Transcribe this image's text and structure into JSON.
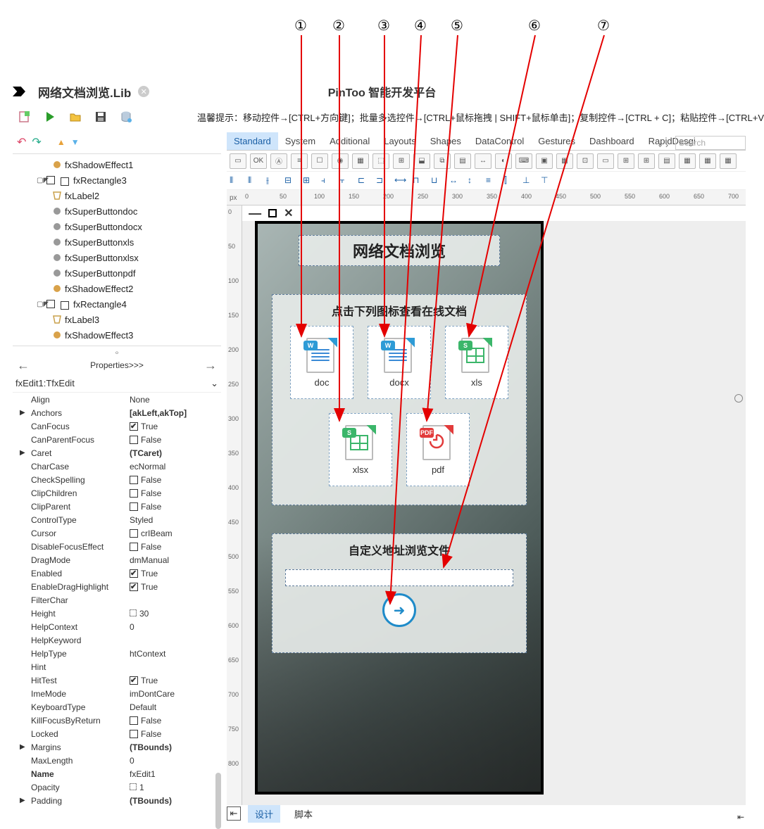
{
  "annotations": [
    "①",
    "②",
    "③",
    "④",
    "⑤",
    "⑥",
    "⑦"
  ],
  "titlebar": {
    "doc_name": "网络文档浏览.Lib",
    "center_title": "PinToo 智能开发平台"
  },
  "hint_text": "温馨提示：移动控件→[CTRL+方向键]；批量多选控件→[CTRL+鼠标拖拽 | SHIFT+鼠标单击]；复制控件→[CTRL + C]；粘贴控件→[CTRL+V]",
  "component_tabs": [
    "Standard",
    "System",
    "Additional",
    "Layouts",
    "Shapes",
    "DataControl",
    "Gestures",
    "Dashboard",
    "RapidDesgi"
  ],
  "component_tabs_active": 0,
  "search_placeholder": "Search",
  "tree_items": [
    {
      "indent": 2,
      "icon": "effect",
      "label": "fxShadowEffect1"
    },
    {
      "indent": 1,
      "icon": "rect",
      "label": "fxRectangle3",
      "expand": true,
      "checkbox": true
    },
    {
      "indent": 2,
      "icon": "label",
      "label": "fxLabel2"
    },
    {
      "indent": 2,
      "icon": "btn",
      "label": "fxSuperButtondoc"
    },
    {
      "indent": 2,
      "icon": "btn",
      "label": "fxSuperButtondocx"
    },
    {
      "indent": 2,
      "icon": "btn",
      "label": "fxSuperButtonxls"
    },
    {
      "indent": 2,
      "icon": "btn",
      "label": "fxSuperButtonxlsx"
    },
    {
      "indent": 2,
      "icon": "btn",
      "label": "fxSuperButtonpdf"
    },
    {
      "indent": 2,
      "icon": "effect",
      "label": "fxShadowEffect2"
    },
    {
      "indent": 1,
      "icon": "rect",
      "label": "fxRectangle4",
      "expand": true,
      "checkbox": true
    },
    {
      "indent": 2,
      "icon": "label",
      "label": "fxLabel3"
    },
    {
      "indent": 2,
      "icon": "effect",
      "label": "fxShadowEffect3"
    }
  ],
  "properties_header": "Properties>>>",
  "selected_component": "fxEdit1:TfxEdit",
  "properties": [
    {
      "name": "Align",
      "value": "None"
    },
    {
      "name": "Anchors",
      "value": "[akLeft,akTop]",
      "tri": true,
      "bold": true
    },
    {
      "name": "CanFocus",
      "value": "True",
      "check": true
    },
    {
      "name": "CanParentFocus",
      "value": "False",
      "check": false
    },
    {
      "name": "Caret",
      "value": "(TCaret)",
      "tri": true,
      "bold": true
    },
    {
      "name": "CharCase",
      "value": "ecNormal"
    },
    {
      "name": "CheckSpelling",
      "value": "False",
      "check": false
    },
    {
      "name": "ClipChildren",
      "value": "False",
      "check": false
    },
    {
      "name": "ClipParent",
      "value": "False",
      "check": false
    },
    {
      "name": "ControlType",
      "value": "Styled"
    },
    {
      "name": "Cursor",
      "value": "crIBeam",
      "check": false
    },
    {
      "name": "DisableFocusEffect",
      "value": "False",
      "check": false
    },
    {
      "name": "DragMode",
      "value": "dmManual"
    },
    {
      "name": "Enabled",
      "value": "True",
      "check": true
    },
    {
      "name": "EnableDragHighlight",
      "value": "True",
      "check": true
    },
    {
      "name": "FilterChar",
      "value": ""
    },
    {
      "name": "Height",
      "value": "30",
      "sizer": true
    },
    {
      "name": "HelpContext",
      "value": "0"
    },
    {
      "name": "HelpKeyword",
      "value": ""
    },
    {
      "name": "HelpType",
      "value": "htContext"
    },
    {
      "name": "Hint",
      "value": ""
    },
    {
      "name": "HitTest",
      "value": "True",
      "check": true
    },
    {
      "name": "ImeMode",
      "value": "imDontCare"
    },
    {
      "name": "KeyboardType",
      "value": "Default"
    },
    {
      "name": "KillFocusByReturn",
      "value": "False",
      "check": false
    },
    {
      "name": "Locked",
      "value": "False",
      "check": false
    },
    {
      "name": "Margins",
      "value": "(TBounds)",
      "tri": true,
      "bold": true
    },
    {
      "name": "MaxLength",
      "value": "0"
    },
    {
      "name": "Name",
      "value": "fxEdit1",
      "boldname": true
    },
    {
      "name": "Opacity",
      "value": "1",
      "sizer": true
    },
    {
      "name": "Padding",
      "value": "(TBounds)",
      "tri": true,
      "bold": true
    }
  ],
  "ruler_h": [
    "0",
    "50",
    "100",
    "150",
    "200",
    "250",
    "300",
    "350",
    "400",
    "450",
    "500",
    "550",
    "600",
    "650",
    "700"
  ],
  "ruler_v": [
    "0",
    "50",
    "100",
    "150",
    "200",
    "250",
    "300",
    "350",
    "400",
    "450",
    "500",
    "550",
    "600",
    "650",
    "700",
    "750",
    "800"
  ],
  "ruler_unit": "px",
  "device": {
    "title": "网络文档浏览",
    "grid_header": "点击下列图标查看在线文档",
    "cards": [
      {
        "label": "doc",
        "type": "word",
        "color": "#2e9bd6",
        "badge": "W",
        "badgebg": "#2e9bd6"
      },
      {
        "label": "docx",
        "type": "word",
        "color": "#2e9bd6",
        "badge": "W",
        "badgebg": "#2e9bd6"
      },
      {
        "label": "xls",
        "type": "sheet",
        "color": "#3bb66a",
        "badge": "S",
        "badgebg": "#3bb66a"
      },
      {
        "label": "xlsx",
        "type": "sheet",
        "color": "#3bb66a",
        "badge": "S",
        "badgebg": "#3bb66a"
      },
      {
        "label": "pdf",
        "type": "pdf",
        "color": "#e23b3b",
        "badge": "PDF",
        "badgebg": "#e23b3b"
      }
    ],
    "custom_header": "自定义地址浏览文件"
  },
  "bottom_tabs": {
    "design": "设计",
    "script": "脚本"
  }
}
